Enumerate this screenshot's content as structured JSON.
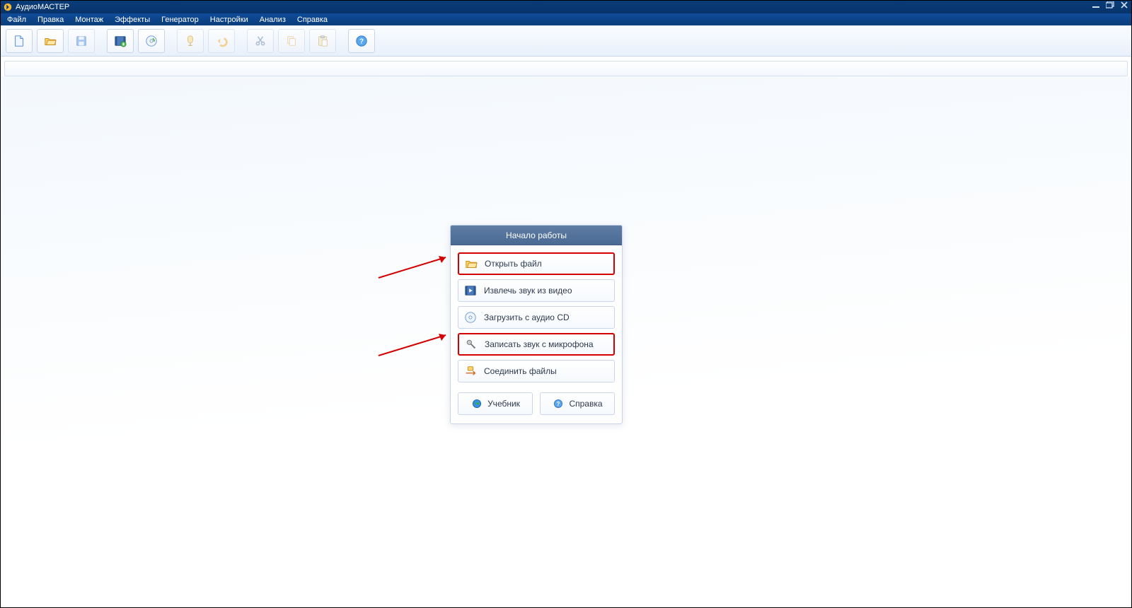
{
  "title": "АудиоМАСТЕР",
  "menus": [
    {
      "label": "Файл"
    },
    {
      "label": "Правка"
    },
    {
      "label": "Монтаж"
    },
    {
      "label": "Эффекты"
    },
    {
      "label": "Генератор"
    },
    {
      "label": "Настройки"
    },
    {
      "label": "Анализ"
    },
    {
      "label": "Справка"
    }
  ],
  "toolbar": {
    "new": "Создать",
    "open": "Открыть",
    "save": "Сохранить",
    "from_video": "Извлечь из видео",
    "from_cd": "Загрузить с CD",
    "record": "Записать",
    "undo": "Отменить",
    "cut": "Вырезать",
    "copy": "Копировать",
    "paste": "Вставить",
    "help": "Справка"
  },
  "start_panel": {
    "title": "Начало работы",
    "open_file": "Открыть файл",
    "extract_video": "Извлечь звук из видео",
    "load_cd": "Загрузить с аудио CD",
    "record_mic": "Записать звук с микрофона",
    "join_files": "Соединить файлы",
    "tutorial": "Учебник",
    "help": "Справка"
  }
}
